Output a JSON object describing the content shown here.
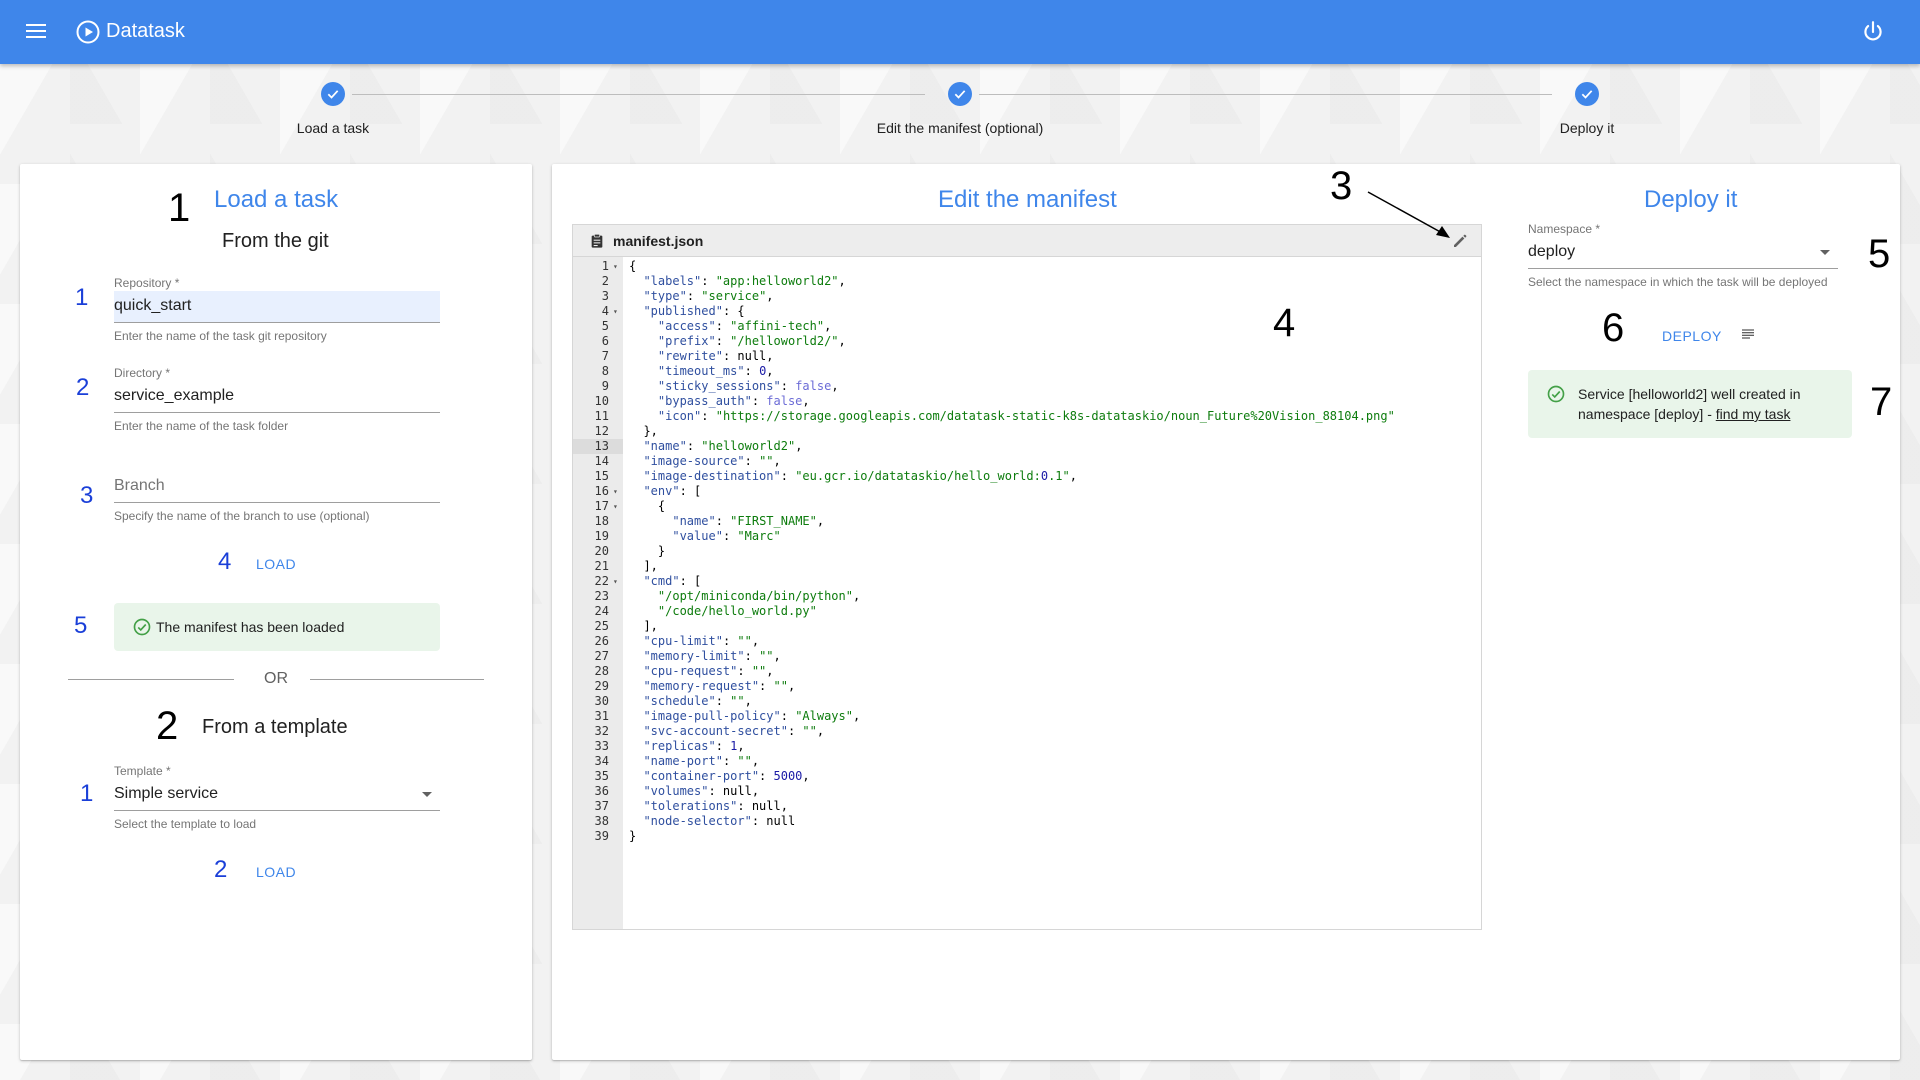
{
  "app": {
    "title": "Datatask"
  },
  "stepper": [
    {
      "label": "Load a task"
    },
    {
      "label": "Edit the manifest (optional)"
    },
    {
      "label": "Deploy it"
    }
  ],
  "load_panel": {
    "title": "Load a task",
    "section_git": {
      "number": "1",
      "subtitle": "From the git"
    },
    "repository": {
      "marker": "1",
      "label": "Repository *",
      "value": "quick_start",
      "hint": "Enter the name of the task git repository"
    },
    "directory": {
      "marker": "2",
      "label": "Directory *",
      "value": "service_example",
      "hint": "Enter the name of the task folder"
    },
    "branch": {
      "marker": "3",
      "placeholder": "Branch",
      "hint": "Specify the name of the branch to use (optional)"
    },
    "load_git": {
      "marker": "4",
      "label": "LOAD"
    },
    "loaded_message": {
      "marker": "5",
      "text": "The manifest has been loaded"
    },
    "or_text": "OR",
    "section_template": {
      "number": "2",
      "subtitle": "From a template"
    },
    "template": {
      "marker": "1",
      "label": "Template *",
      "value": "Simple service",
      "hint": "Select the template to load"
    },
    "load_template": {
      "marker": "2",
      "label": "LOAD"
    }
  },
  "manifest_panel": {
    "title": "Edit the manifest",
    "file_name": "manifest.json",
    "edit_marker": "3",
    "editor_marker": "4",
    "active_line": 13,
    "folds": [
      1,
      4,
      16,
      17,
      22
    ],
    "lines": [
      "{",
      "  \"labels\": \"app:helloworld2\",",
      "  \"type\": \"service\",",
      "  \"published\": {",
      "    \"access\": \"affini-tech\",",
      "    \"prefix\": \"/helloworld2/\",",
      "    \"rewrite\": null,",
      "    \"timeout_ms\": 0,",
      "    \"sticky_sessions\": false,",
      "    \"bypass_auth\": false,",
      "    \"icon\": \"https://storage.googleapis.com/datatask-static-k8s-datataskio/noun_Future%20Vision_88104.png\"",
      "  },",
      "  \"name\": \"helloworld2\",",
      "  \"image-source\": \"\",",
      "  \"image-destination\": \"eu.gcr.io/datataskio/hello_world:0.1\",",
      "  \"env\": [",
      "    {",
      "      \"name\": \"FIRST_NAME\",",
      "      \"value\": \"Marc\"",
      "    }",
      "  ],",
      "  \"cmd\": [",
      "    \"/opt/miniconda/bin/python\",",
      "    \"/code/hello_world.py\"",
      "  ],",
      "  \"cpu-limit\": \"\",",
      "  \"memory-limit\": \"\",",
      "  \"cpu-request\": \"\",",
      "  \"memory-request\": \"\",",
      "  \"schedule\": \"\",",
      "  \"image-pull-policy\": \"Always\",",
      "  \"svc-account-secret\": \"\",",
      "  \"replicas\": 1,",
      "  \"name-port\": \"\",",
      "  \"container-port\": 5000,",
      "  \"volumes\": null,",
      "  \"tolerations\": null,",
      "  \"node-selector\": null",
      "}"
    ]
  },
  "deploy_panel": {
    "title": "Deploy it",
    "namespace": {
      "marker": "5",
      "label": "Namespace *",
      "value": "deploy",
      "hint": "Select the namespace in which the task will be deployed"
    },
    "deploy_button": {
      "marker": "6",
      "label": "DEPLOY"
    },
    "result": {
      "marker": "7",
      "text": "Service [helloworld2] well created in namespace [deploy] - ",
      "link": "find my task"
    }
  },
  "colors": {
    "primary": "#3f86ea",
    "success_bg": "#e9f5ea",
    "success_icon": "#43a047",
    "annotation": "#1a3fd8"
  }
}
